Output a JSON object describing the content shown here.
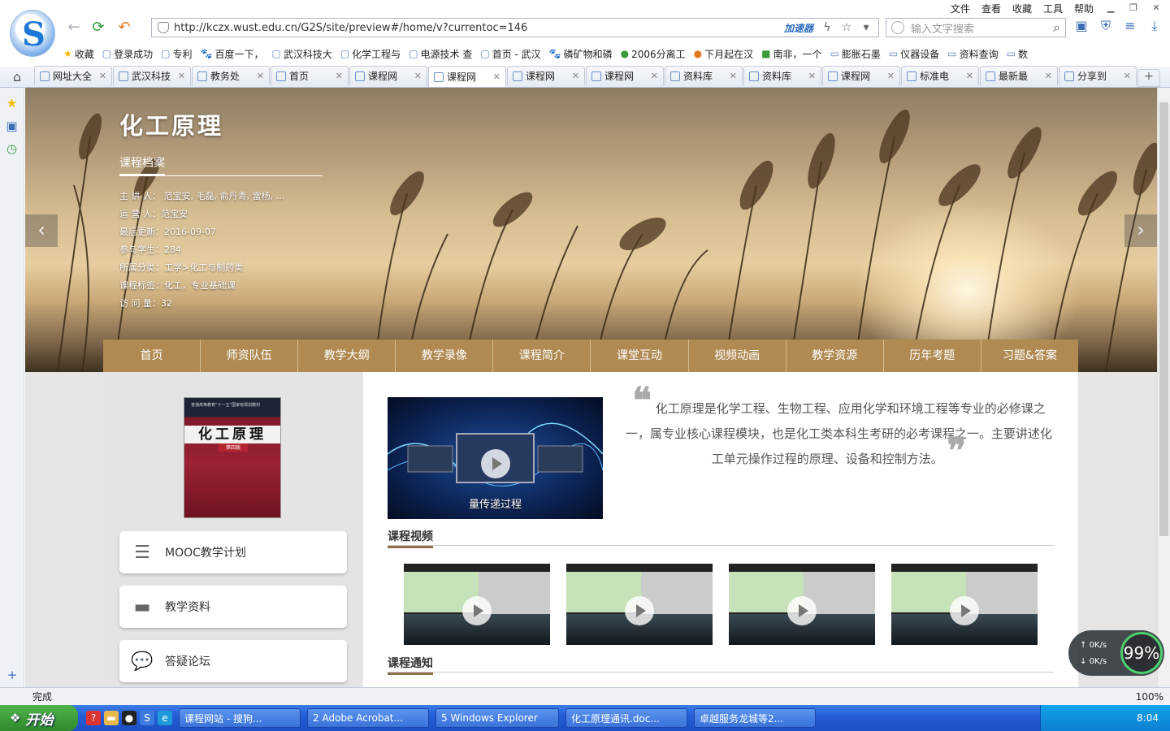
{
  "menubar": {
    "items": [
      "文件",
      "查看",
      "收藏",
      "工具",
      "帮助"
    ]
  },
  "address": {
    "url": "http://kczx.wust.edu.cn/G2S/site/preview#/home/v?currentoc=146",
    "accelerator": "加速器"
  },
  "search": {
    "placeholder": "输入文字搜索"
  },
  "bookmarks": [
    "收藏",
    "登录成功",
    "专利",
    "百度一下，",
    "武汉科技大",
    "化学工程与",
    "电源技术 查",
    "首页 - 武汉",
    "磷矿物和磷",
    "2006分离工",
    "下月起在汉",
    "南非，一个",
    "膨胀石墨",
    "仪器设备",
    "资料查询",
    "数"
  ],
  "tabs": [
    "网址大全",
    "武汉科技",
    "教务处",
    "首页",
    "课程网",
    "课程网",
    "课程网",
    "课程网",
    "资料库",
    "资料库",
    "课程网",
    "标准电",
    "最新最",
    "分享到"
  ],
  "banner": {
    "title": "化工原理",
    "subtitle": "课程档案",
    "meta": [
      "主 讲 人： 范宝安, 毛磊, 俞丹青, 雷杨, …",
      "运 营 人：范宝安",
      "最后更新：2016-09-07",
      "参与学生：284",
      "所属分类：工学>化工与制药类",
      "课程标签：化工，专业基础课",
      "访 问 量：32"
    ]
  },
  "nav": [
    "首页",
    "师资队伍",
    "教学大纲",
    "教学录像",
    "课程简介",
    "课堂互动",
    "视频动画",
    "教学资源",
    "历年考题",
    "习题&答案"
  ],
  "book": {
    "title": "化工原理",
    "edition": "第四版",
    "series": "普通高等教育“十一五”国家级规划教材"
  },
  "sidebar_buttons": [
    "MOOC教学计划",
    "教学资料",
    "答疑论坛"
  ],
  "intro": {
    "text": "化工原理是化学工程、生物工程、应用化学和环境工程等专业的必修课之一，属专业核心课程模块，也是化工类本科生考研的必考课程之一。主要讲述化工单元操作过程的原理、设备和控制方法。"
  },
  "video": {
    "caption": "量传递过程"
  },
  "sections": {
    "videos": "课程视频",
    "notices": "课程通知"
  },
  "status": {
    "text": "完成",
    "zoom": "100%",
    "speed_pct": "99%",
    "up": "0K/s",
    "down": "0K/s"
  },
  "taskbar": {
    "start": "开始",
    "items": [
      "课程网站 - 搜狗...",
      "2 Adobe Acrobat...",
      "5 Windows Explorer",
      "化工原理通讯.doc...",
      "卓越服务龙城等2..."
    ],
    "time": "8:04"
  }
}
